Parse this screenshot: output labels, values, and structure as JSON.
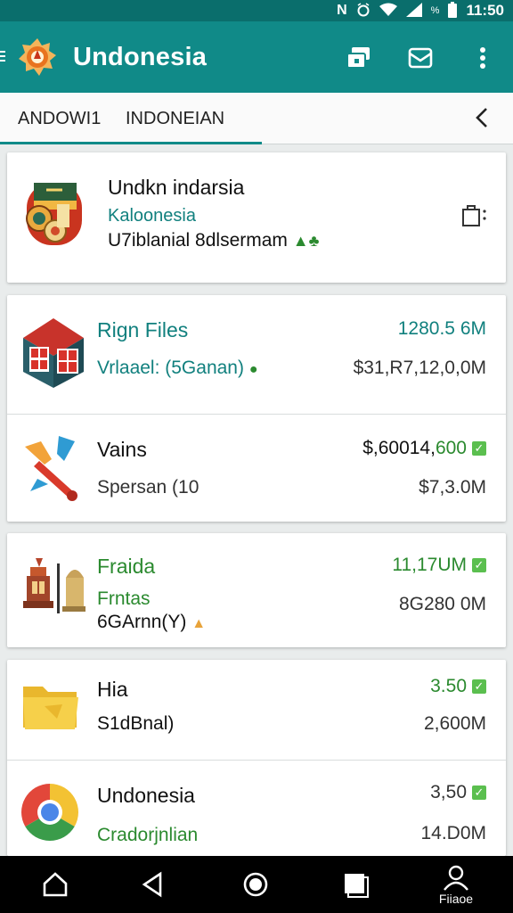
{
  "status_bar": {
    "icons": [
      "nfc-icon",
      "alarm-icon",
      "wifi-icon",
      "signal-icon",
      "battery-icon"
    ],
    "battery_text": "%",
    "time": "11:50"
  },
  "app_bar": {
    "title": "Undonesia",
    "actions": [
      "cards-icon",
      "mail-check-icon",
      "more-vert-icon"
    ],
    "color": "#108a88"
  },
  "tabs": {
    "items": [
      {
        "label": "ANDOWI1"
      },
      {
        "label": "INDONEIAN"
      }
    ],
    "active_index": 0
  },
  "header_card": {
    "title": "Undkn indarsia",
    "subtitle": "Kaloonesia",
    "detail": "U7iblanial 8dlsermam",
    "action_icon": "bag-icon"
  },
  "items": [
    {
      "title": "Rign Files",
      "subtitle": "Vrlaael: (5Ganan)",
      "right_top": "1280.5 6M",
      "right_bottom": "$31,R7,12,0,0M",
      "icon": "building-icon"
    },
    {
      "title": "Vains",
      "subtitle": "Spersan (10",
      "right_top_prefix": "$,60014,",
      "right_top_suffix": "600",
      "right_bottom": "$7,3.0M",
      "icon": "pen-icon"
    },
    {
      "title": "Fraida",
      "subtitle": "Frntas",
      "subtitle2": "6GArnn(Y)",
      "right_top": "11,17UM",
      "right_bottom": "8G280 0M",
      "icon": "temple-icon"
    },
    {
      "title": "Hia",
      "subtitle": "S1dBnal)",
      "right_top": "3.50",
      "right_bottom": "2,600M",
      "icon": "folder-icon"
    },
    {
      "title": "Undonesia",
      "subtitle": "Cradorjnlian",
      "right_top": "3,50",
      "right_bottom": "14.D0M",
      "icon": "chrome-icon"
    }
  ],
  "nav_bar": {
    "buttons": [
      "home-icon",
      "back-icon",
      "circle-icon",
      "recents-icon",
      "profile-icon"
    ],
    "profile_label": "Fiiaoe"
  }
}
